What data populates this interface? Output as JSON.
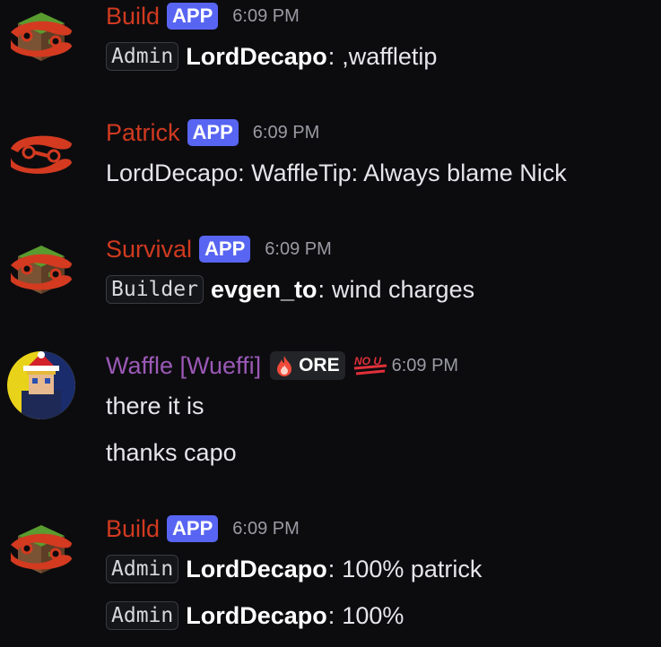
{
  "colors": {
    "background": "#0c0c0f",
    "bot_name": "#d13a1f",
    "waffle_name": "#9b59b6",
    "app_badge": "#5865f2",
    "timestamp": "#9a9aa3"
  },
  "messages": [
    {
      "author": "Build",
      "badge": "APP",
      "time": "6:09 PM",
      "avatar_icon": "minecraft-grass-block-logo-icon",
      "lines": [
        {
          "role": "Admin",
          "player": "LordDecapo",
          "sep": ":",
          "text": ",waffletip"
        }
      ]
    },
    {
      "author": "Patrick",
      "badge": "APP",
      "time": "6:09 PM",
      "avatar_icon": "circuit-s-logo-icon",
      "lines": [
        {
          "text": "LordDecapo: WaffleTip: Always blame Nick"
        }
      ]
    },
    {
      "author": "Survival",
      "badge": "APP",
      "time": "6:09 PM",
      "avatar_icon": "minecraft-grass-block-logo-icon",
      "lines": [
        {
          "role": "Builder",
          "player": "evgen_to",
          "sep": ":",
          "text": "wind charges"
        }
      ]
    },
    {
      "author": "Waffle [Wueffi]",
      "role_pill": "ORE",
      "role_pill_icon": "fire-icon",
      "extra_icon": "no-u-icon",
      "time": "6:09 PM",
      "avatar_icon": "santa-hat-avatar-icon",
      "lines": [
        {
          "text": "there it is"
        },
        {
          "text": "thanks capo"
        }
      ]
    },
    {
      "author": "Build",
      "badge": "APP",
      "time": "6:09 PM",
      "avatar_icon": "minecraft-grass-block-logo-icon",
      "lines": [
        {
          "role": "Admin",
          "player": "LordDecapo",
          "sep": ":",
          "text": "100% patrick"
        },
        {
          "role": "Admin",
          "player": "LordDecapo",
          "sep": ":",
          "text": "100%"
        }
      ]
    }
  ]
}
